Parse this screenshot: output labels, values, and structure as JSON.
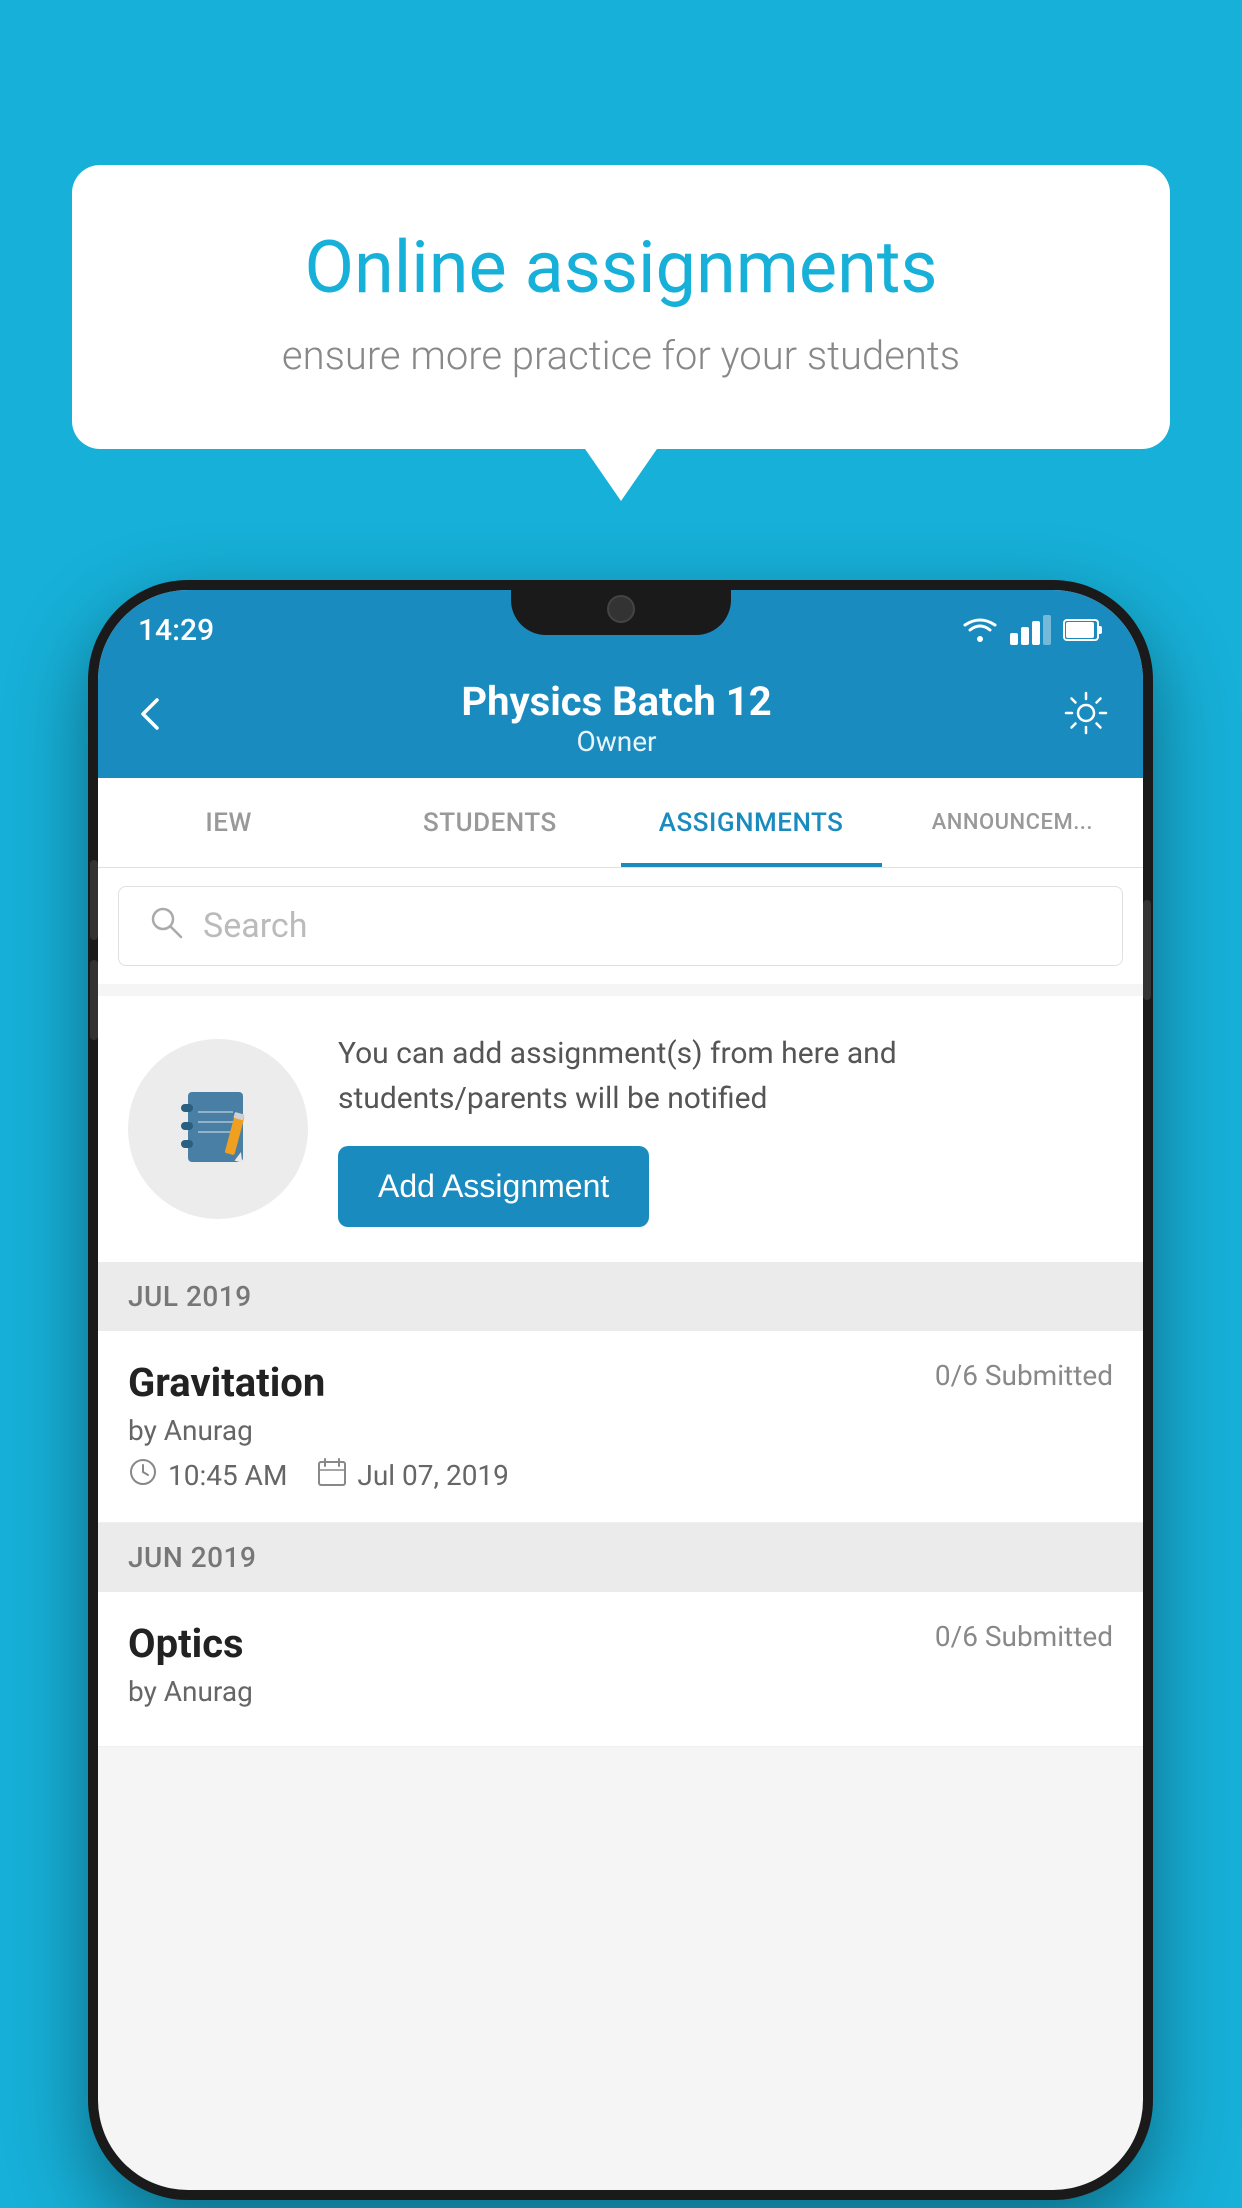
{
  "background_color": "#17b0d8",
  "speech_bubble": {
    "title": "Online assignments",
    "subtitle": "ensure more practice for your students"
  },
  "phone": {
    "status_bar": {
      "time": "14:29"
    },
    "header": {
      "title": "Physics Batch 12",
      "subtitle": "Owner"
    },
    "tabs": [
      {
        "label": "IEW",
        "active": false
      },
      {
        "label": "STUDENTS",
        "active": false
      },
      {
        "label": "ASSIGNMENTS",
        "active": true
      },
      {
        "label": "ANNOUNCEM...",
        "active": false
      }
    ],
    "search": {
      "placeholder": "Search"
    },
    "add_card": {
      "description": "You can add assignment(s) from here and students/parents will be notified",
      "button_label": "Add Assignment"
    },
    "sections": [
      {
        "month": "JUL 2019",
        "assignments": [
          {
            "title": "Gravitation",
            "submitted": "0/6 Submitted",
            "author": "by Anurag",
            "time": "10:45 AM",
            "date": "Jul 07, 2019"
          }
        ]
      },
      {
        "month": "JUN 2019",
        "assignments": [
          {
            "title": "Optics",
            "submitted": "0/6 Submitted",
            "author": "by Anurag",
            "time": "",
            "date": ""
          }
        ]
      }
    ]
  }
}
